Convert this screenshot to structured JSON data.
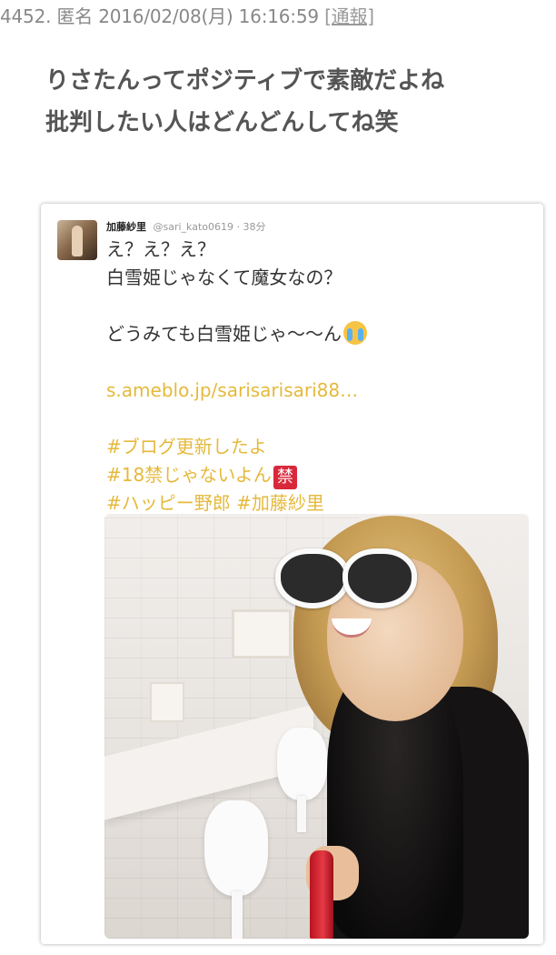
{
  "post": {
    "number": "4452.",
    "author": "匿名",
    "datetime": "2016/02/08(月) 16:16:59",
    "report_link": "[通報]",
    "body_lines": [
      "りさたんってポジティブで素敵だよね",
      "批判したい人はどんどんしてね笑"
    ]
  },
  "tweet": {
    "name": "加藤紗里",
    "handle_time": "@sari_kato0619 · 38分",
    "lines": {
      "l1": "え？え？え？",
      "l2": "白雪姫じゃなくて魔女なの？",
      "l3": "どうみても白雪姫じゃ〜〜ん",
      "link": "s.ameblo.jp/sarisarisari88…",
      "tag1": "#ブログ更新したよ",
      "tag2": "#18禁じゃないよん",
      "tag2_badge": "禁",
      "tag3": "#ハッピー野郎 #加藤紗里"
    },
    "colors": {
      "link": "#e5b93b",
      "badge_bg": "#d9283b"
    },
    "icons": {
      "emoji": "crying-face-emoji",
      "badge": "prohibited-kanji-badge"
    }
  }
}
